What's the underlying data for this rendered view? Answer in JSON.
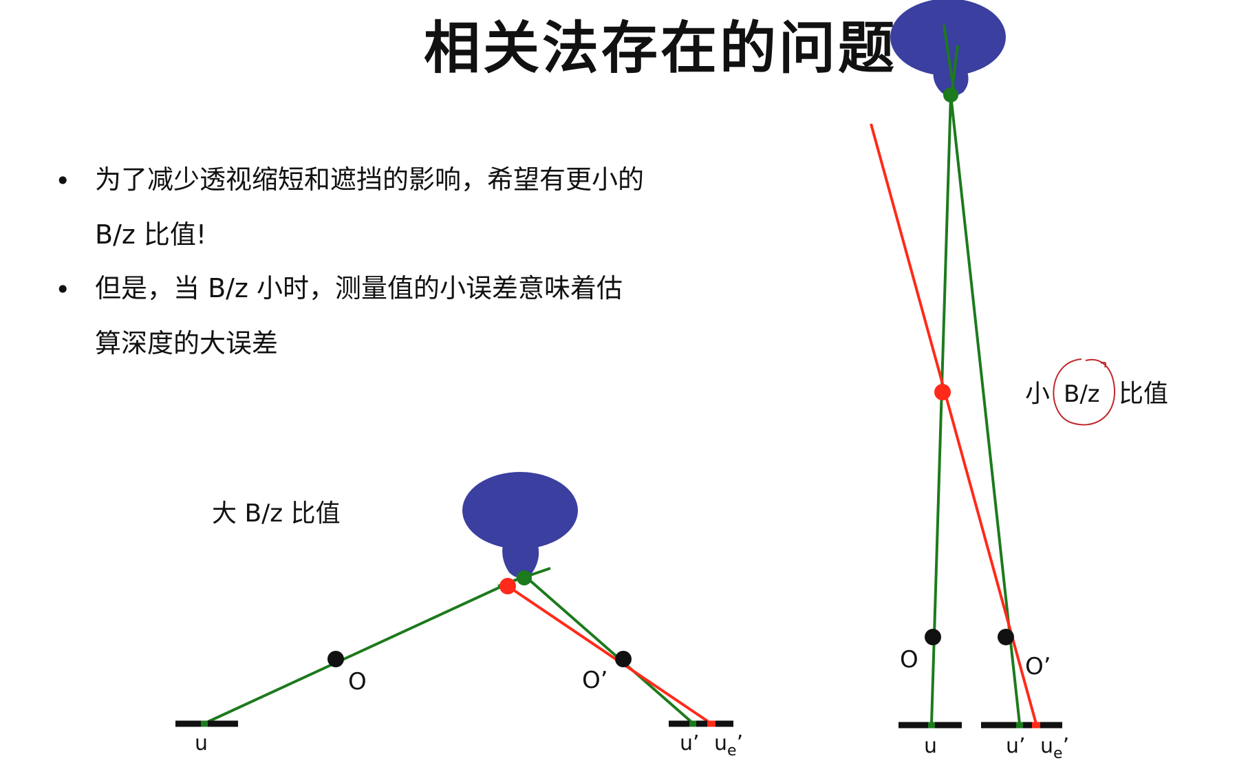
{
  "title": "相关法存在的问题",
  "bullets": [
    {
      "marker": "•",
      "lines": [
        "为了减少透视缩短和遮挡的影响，希望有更小的",
        "B/z 比值!"
      ]
    },
    {
      "marker": "•",
      "lines": [
        "但是，当 B/z 小时，测量值的小误差意味着估",
        "算深度的大误差"
      ]
    }
  ],
  "left_diagram": {
    "caption": "大 B/z 比值",
    "label_o": "O",
    "label_o_prime": "O’",
    "label_u": "u",
    "label_u_prime": "u’",
    "label_ue_base": "u",
    "label_ue_sub": "e",
    "label_ue_tick": "’"
  },
  "right_diagram": {
    "caption_left": "小",
    "caption_circled": "B/z",
    "caption_right": "比值",
    "label_o": "O",
    "label_o_prime": "O’",
    "label_u": "u",
    "label_u_prime": "u’",
    "label_ue_base": "u",
    "label_ue_sub": "e",
    "label_ue_tick": "’"
  },
  "colors": {
    "object": "#3a3fa0",
    "ray_true": "#1d7a1d",
    "ray_error": "#ff2a1a",
    "annotation": "#c0262c",
    "point": "#111111"
  }
}
